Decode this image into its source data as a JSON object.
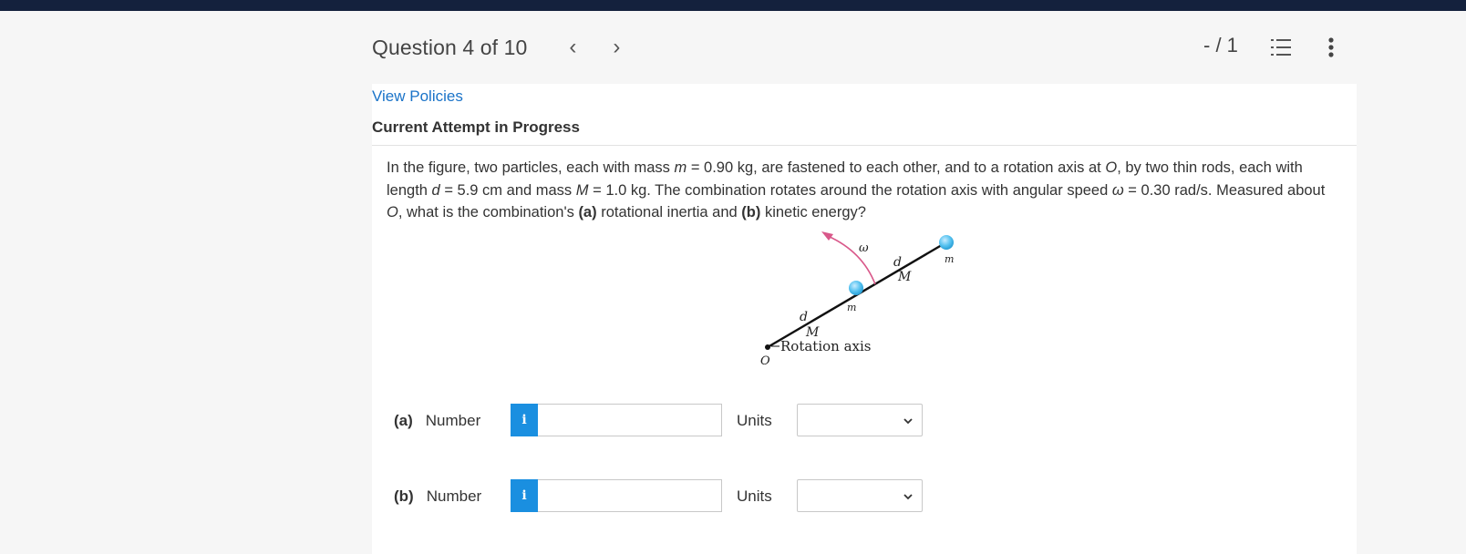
{
  "header": {
    "question_counter": "Question 4 of 10",
    "prev_glyph": "‹",
    "next_glyph": "›",
    "score": "- / 1"
  },
  "links": {
    "view_policies": "View Policies"
  },
  "status": "Current Attempt in Progress",
  "question": {
    "p1": "In the figure, two particles, each with mass ",
    "v_m": "m",
    "p2": " = 0.90 kg, are fastened to each other, and to a rotation axis at ",
    "v_O1": "O",
    "p3": ", by two thin rods, each with length ",
    "v_d": "d",
    "p4": " = 5.9 cm and mass ",
    "v_M": "M",
    "p5": " = 1.0 kg. The combination rotates around the rotation axis with angular speed ",
    "v_w": "ω",
    "p6": " = 0.30 rad/s. Measured about ",
    "v_O2": "O",
    "p7": ", what is the combination's ",
    "b_a": "(a)",
    "p8": " rotational inertia and ",
    "b_b": "(b)",
    "p9": " kinetic energy?"
  },
  "figure": {
    "omega": "ω",
    "d_upper": "d",
    "M_upper": "M",
    "m_upper": "m",
    "m_lower": "m",
    "d_lower": "d",
    "M_lower": "M",
    "axis_label": "Rotation axis",
    "origin_label": "O"
  },
  "parts": [
    {
      "label": "(a)",
      "number_label": "Number",
      "info": "i",
      "value": "",
      "units_label": "Units",
      "units_value": ""
    },
    {
      "label": "(b)",
      "number_label": "Number",
      "info": "i",
      "value": "",
      "units_label": "Units",
      "units_value": ""
    }
  ],
  "icons": {
    "list": "list-icon",
    "more": "more-vertical-icon",
    "info": "info-icon",
    "chevron": "chevron-down-icon"
  },
  "colors": {
    "topbar": "#14213d",
    "link": "#1a73c8",
    "info_button": "#1a8fe0",
    "arrow": "#d9588a",
    "particle": "#56c2f0"
  }
}
